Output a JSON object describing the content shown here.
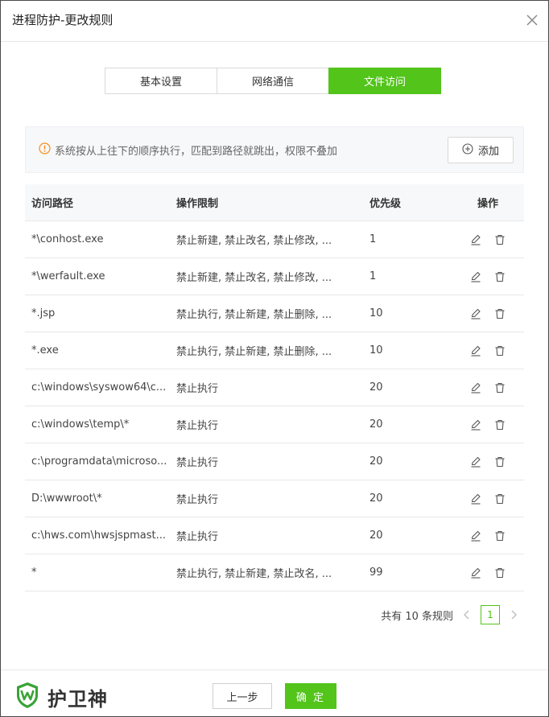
{
  "window": {
    "title": "进程防护-更改规则"
  },
  "tabs": [
    {
      "label": "基本设置"
    },
    {
      "label": "网络通信"
    },
    {
      "label": "文件访问"
    }
  ],
  "notice": {
    "text": "系统按从上往下的顺序执行，匹配到路径就跳出，权限不叠加",
    "add_label": "添加"
  },
  "table": {
    "headers": {
      "path": "访问路径",
      "limit": "操作限制",
      "priority": "优先级",
      "action": "操作"
    },
    "rows": [
      {
        "path": "*\\conhost.exe",
        "limit": "禁止新建, 禁止改名, 禁止修改, ...",
        "priority": "1"
      },
      {
        "path": "*\\werfault.exe",
        "limit": "禁止新建, 禁止改名, 禁止修改, ...",
        "priority": "1"
      },
      {
        "path": "*.jsp",
        "limit": "禁止执行, 禁止新建, 禁止删除, ...",
        "priority": "10"
      },
      {
        "path": "*.exe",
        "limit": "禁止执行, 禁止新建, 禁止删除, ...",
        "priority": "10"
      },
      {
        "path": "c:\\windows\\syswow64\\c...",
        "limit": "禁止执行",
        "priority": "20"
      },
      {
        "path": "c:\\windows\\temp\\*",
        "limit": "禁止执行",
        "priority": "20"
      },
      {
        "path": "c:\\programdata\\microso...",
        "limit": "禁止执行",
        "priority": "20"
      },
      {
        "path": "D:\\wwwroot\\*",
        "limit": "禁止执行",
        "priority": "20"
      },
      {
        "path": "c:\\hws.com\\hwsjspmast...",
        "limit": "禁止执行",
        "priority": "20"
      },
      {
        "path": "*",
        "limit": "禁止执行, 禁止新建, 禁止改名, ...",
        "priority": "99"
      }
    ]
  },
  "pager": {
    "summary": "共有 10 条规则",
    "current": "1"
  },
  "footer": {
    "logo_text": "护卫神",
    "prev_label": "上一步",
    "ok_label": "确 定"
  },
  "colors": {
    "accent": "#52c41a",
    "warning": "#fa8c16"
  }
}
